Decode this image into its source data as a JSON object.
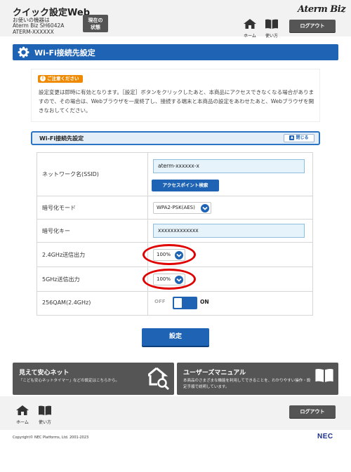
{
  "header": {
    "app_title": "クイック設定Web",
    "model_caption": "お使いの機器は",
    "model_name": "Aterm Biz SH6042A",
    "model_id": "ATERM-XXXXXX",
    "status_button": "現在の\n状態",
    "brand": "Aterm Biz",
    "nav_home": "ホーム",
    "nav_manual": "使い方",
    "logout": "ログアウト"
  },
  "page_title": "Wi-Fi接続先設定",
  "notice": {
    "badge": "ご注意ください",
    "text": "設定変更は即時に有効となります。［設定］ボタンをクリックしたあと、本商品にアクセスできなくなる場合がありますので、その場合は、Webブラウザを一度終了し、接続する端末と本商品の設定をあわせたあと、Webブラウザを開きなおしてください。"
  },
  "section": {
    "title": "Wi-Fi接続先設定",
    "close_label": "閉じる"
  },
  "fields": {
    "ssid_label": "ネットワーク名(SSID)",
    "ssid_value": "aterm-xxxxxx-x",
    "ap_search": "アクセスポイント検索",
    "encryption_label": "暗号化モード",
    "encryption_value": "WPA2-PSK(AES)",
    "key_label": "暗号化キー",
    "key_value": "xxxxxxxxxxxxx",
    "power24_label": "2.4GHz送信出力",
    "power24_value": "100%",
    "power5_label": "5GHz送信出力",
    "power5_value": "100%",
    "qam_label": "256QAM(2.4GHz)",
    "qam_off": "OFF",
    "qam_on": "ON"
  },
  "submit": "設定",
  "banners": {
    "left_title": "見えて安心ネット",
    "left_desc": "「こども安心ネットタイマー」などの設定はこちらから。",
    "right_title": "ユーザーズマニュアル",
    "right_desc": "本商品のさまざまな機能を利用してできることを、わかりやすい操作・設定手順で説明しています。"
  },
  "footer": {
    "nav_home": "ホーム",
    "nav_manual": "使い方",
    "logout": "ログアウト",
    "copyright": "Copyright© NEC Platforms, Ltd. 2001-2023",
    "nec_logo": "NEC"
  },
  "colors": {
    "primary": "#1e63b4",
    "header_bg": "#f2f2f2",
    "dark_button": "#555555",
    "notice_badge": "#ef8a00",
    "highlight": "#e00000"
  },
  "icons": [
    "home-icon",
    "book-icon",
    "gear-icon",
    "chevron-down-icon",
    "chevron-up-icon",
    "exclamation-icon",
    "house-search-icon"
  ]
}
